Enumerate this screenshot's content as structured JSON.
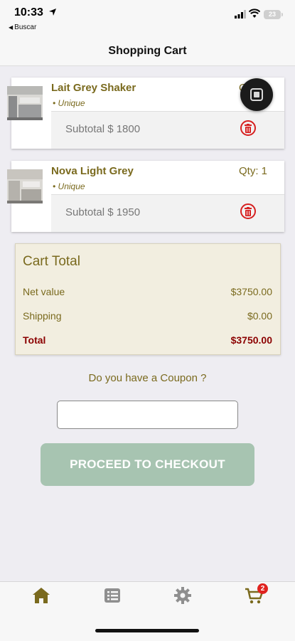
{
  "status_bar": {
    "time": "10:33",
    "back_app": "Buscar",
    "battery": "23"
  },
  "header": {
    "title": "Shopping Cart"
  },
  "cart_items": [
    {
      "name": "Lait Grey Shaker",
      "variant": "Unique",
      "qty": "Qty: 1",
      "subtotal": "Subtotal $ 1800"
    },
    {
      "name": "Nova Light Grey",
      "variant": "Unique",
      "qty": "Qty: 1",
      "subtotal": "Subtotal $ 1950"
    }
  ],
  "cart_total": {
    "title": "Cart Total",
    "net_label": "Net value",
    "net_value": "$3750.00",
    "shipping_label": "Shipping",
    "shipping_value": "$0.00",
    "total_label": "Total",
    "total_value": "$3750.00"
  },
  "coupon": {
    "label": "Do you have a Coupon ?",
    "value": "",
    "placeholder": ""
  },
  "checkout": {
    "label": "PROCEED TO CHECKOUT"
  },
  "tab_bar": {
    "items": [
      {
        "icon": "home-icon",
        "active": true
      },
      {
        "icon": "list-icon",
        "active": false
      },
      {
        "icon": "gear-icon",
        "active": false
      },
      {
        "icon": "cart-icon",
        "active": false
      }
    ],
    "cart_badge": "2"
  },
  "colors": {
    "accent": "#7a6a1e",
    "total": "#8b0000",
    "checkout_button": "#a7c4b1",
    "delete": "#d62020",
    "badge": "#e0231f"
  }
}
